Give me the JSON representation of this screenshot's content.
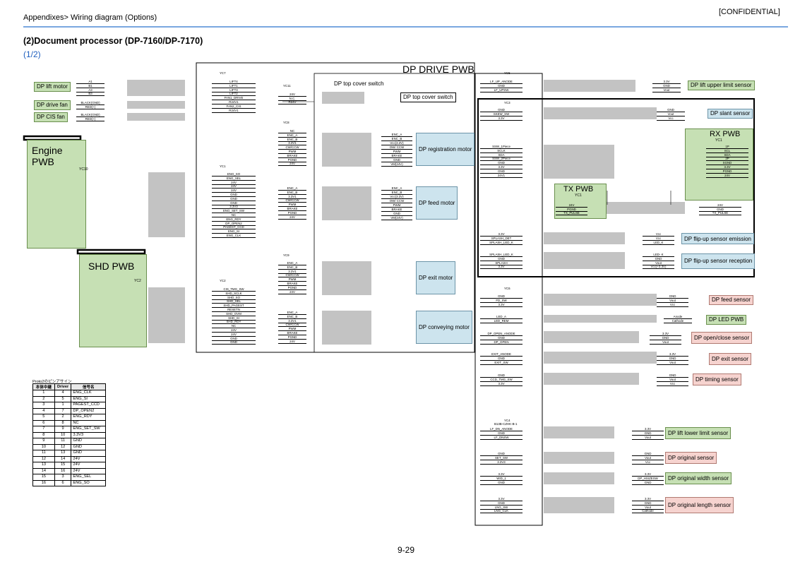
{
  "header": {
    "breadcrumb": "Appendixes> Wiring diagram (Options)",
    "confidential": "[CONFIDENTIAL]"
  },
  "page": {
    "title": "(2)Document processor (DP-7160/DP-7170)",
    "part": "(1/2)",
    "number": "9-29"
  },
  "boards": {
    "dp_drive": "DP DRIVE PWB",
    "engine": "Engine PWB",
    "shd": "SHD PWB",
    "rx": "RX PWB",
    "tx": "TX PWB"
  },
  "connectors": {
    "yc7": "YC7",
    "yc11": "YC11",
    "yc8": "YC8",
    "yc1": "YC1",
    "yc9": "YC9",
    "yc2": "YC2",
    "yc5": "YC5",
    "yc3": "YC3",
    "yc6": "YC6",
    "yc4": "YC4",
    "yc4_part": "B13B-CZHK-B-1",
    "yc10": "YC10",
    "shd_yc2": "YC2",
    "rx_yc1": "YC1",
    "tx_yc1": "YC1"
  },
  "components": {
    "lift_motor": "DP lift motor",
    "drive_fan": "DP drive fan",
    "cis_fan": "DP CIS fan",
    "top_cover_switch_in": "DP top cover switch",
    "top_cover_switch": "DP top cover switch",
    "registration_motor": "DP registration motor",
    "feed_motor": "DP feed motor",
    "exit_motor": "DP exit motor",
    "conveying_motor": "DP conveying motor",
    "lift_upper_limit": "DP lift upper limit sensor",
    "slant_sensor": "DP slant sensor",
    "flipup_emission": "DP flip-up sensor emission",
    "flipup_reception": "DP flip-up sensor reception",
    "feed_sensor": "DP feed sensor",
    "led_pwb": "DP LED PWB",
    "open_close_sensor": "DP open/close sensor",
    "exit_sensor": "DP exit sensor",
    "timing_sensor": "DP timing sensor",
    "lift_lower_limit": "DP lift lower limit sensor",
    "original_sensor": "DP original sensor",
    "original_width": "DP original width sensor",
    "original_length": "DP original length sensor"
  },
  "signals": {
    "lift_motor_wires": [
      "A1",
      "B1",
      "A3",
      "B3"
    ],
    "fan_wires": [
      "BLACK(GND)",
      "RED(+)"
    ],
    "yc7": [
      "LIFT4",
      "LIFT1",
      "LIFT3",
      "LIFT2",
      "FAN1_DRIVE",
      "R24V1",
      "FAN2_CIS",
      "R24V1"
    ],
    "yc11": [
      "24V",
      "N.C.",
      "R24V"
    ],
    "yc8_reg": [
      "NC",
      "ENC_A",
      "ENC_B",
      "3.3V1",
      "CW/CCW",
      "PWM",
      "BRAKE",
      "PGND",
      "24V"
    ],
    "reg_motor": [
      "ENC_A",
      "ENC_B",
      "Vcc(3.3V)",
      "OW/ CCW",
      "PWM",
      "BRAKE",
      "GND",
      "VM(24V)"
    ],
    "yc8_feed": [
      "ENC_A",
      "ENC_B",
      "3.3V1",
      "CW/CCW",
      "PWM",
      "BRAKE",
      "PGND",
      "24V"
    ],
    "feed_motor": [
      "ENC_A",
      "ENC_B",
      "Vcc(3.3V)",
      "OW/ CCW",
      "PWM",
      "BRAKE",
      "GND",
      "VM(24V)"
    ],
    "yc1": [
      "ENG_SO",
      "ENG_SEL",
      "24V",
      "24V",
      "24V",
      "GND",
      "GND",
      "GND",
      "3.3V3",
      "ENG_SET_SW",
      "NC",
      "ENG_RDY",
      "DP_OPEN2",
      "PAGEST_CCD",
      "ENG_SI",
      "ENG_CLK"
    ],
    "yc9_exit": [
      "ENC_A",
      "ENC_B",
      "3.3V1",
      "CW/CCW",
      "PWM",
      "BRAKE",
      "PGND",
      "24V"
    ],
    "yc9_conv": [
      "ENC_A",
      "ENC_B",
      "3.3V1",
      "CW/CCW",
      "PWM",
      "BRAKE",
      "PGND",
      "24V"
    ],
    "yc2": [
      "CIS_TMG_SW",
      "SHD_SCLK",
      "SHD_SO",
      "SHD_SEL",
      "SHD_PAGEST",
      "RESETN",
      "SHD_OVM",
      "SHD_SI",
      "SHD_RDY",
      "NC",
      "24V",
      "24V",
      "GND",
      "GND"
    ],
    "yc5": [
      "LF_UP_ANODE",
      "GND",
      "LF_UPSW"
    ],
    "lift_upper": [
      "3.3V",
      "GND",
      "Vout"
    ],
    "yc3_slant": [
      "GND",
      "SKEW_SW",
      "3.3V"
    ],
    "slant": [
      "GND",
      "Vout",
      "Vcc"
    ],
    "yc3_tx": [
      "SSW_1Piece",
      "SCLK",
      "SDA",
      "SSW_2Piece",
      "GND",
      "3.3V",
      "GND",
      "24V1"
    ],
    "rx": [
      "1P",
      "SCL",
      "SDA",
      "2P",
      "SGND",
      "3.3V",
      "PGND",
      "24V"
    ],
    "tx_in": [
      "24V",
      "PGND",
      "TX_PULSE"
    ],
    "tx_out": [
      "24V",
      "GND",
      "TX_PULSE"
    ],
    "yc3_emit": [
      "3.3V",
      "SPLASH_DET",
      "SPLASH_LED_K"
    ],
    "emit": [
      "Vcc",
      "Vcc",
      "LED_K"
    ],
    "yc3_recv": [
      "SPLASH_LED_K",
      "GND",
      "SPLASH",
      "3.3V"
    ],
    "recv": [
      "LED- K",
      "GND",
      "Vout",
      "Vcc(+3.3V)"
    ],
    "yc6_feed": [
      "GND",
      "FD_SW",
      "3.3V"
    ],
    "feed_s": [
      "GND",
      "Vout",
      "Vcc"
    ],
    "yc6_led": [
      "LED_A",
      "LED_REM"
    ],
    "led": [
      "Anode",
      "Cathode"
    ],
    "yc6_open": [
      "DP_OPEN_ANODE",
      "GND",
      "DP_OPEN"
    ],
    "open": [
      "3.3V",
      "GND",
      "Vout"
    ],
    "yc6_exit": [
      "EXIT_ANODE",
      "GND",
      "EXIT_SW"
    ],
    "exit_s": [
      "3.3V",
      "GND",
      "Vout"
    ],
    "yc6_tmg": [
      "GND",
      "CCD_TMG_SW",
      "3.3V"
    ],
    "tmg": [
      "GND",
      "Vout",
      "Vcc"
    ],
    "yc4_lower": [
      "LF_DN_ANODE",
      "GND",
      "LF_DNSW"
    ],
    "lower": [
      "3.3V",
      "GND",
      "Vout"
    ],
    "yc4_orig": [
      "GND",
      "SET_SW",
      "3.3V3"
    ],
    "orig": [
      "GND",
      "Vout",
      "Vcc"
    ],
    "yc4_width": [
      "3.3V",
      "WID_1",
      "GND"
    ],
    "width": [
      "3.3V",
      "DP_HSIZESW",
      "GND"
    ],
    "yc4_length": [
      "3.3V",
      "GND",
      "LNG_SW",
      "LNG_CLK"
    ],
    "length": [
      "3.3V",
      "GND",
      "Vout",
      "Cathode"
    ]
  },
  "pin_table": {
    "caption": "Proto2のピンアサイン",
    "headers": [
      "本体中継",
      "Driver",
      "信号名"
    ],
    "rows": [
      [
        "1",
        "4",
        "ENG_CLK"
      ],
      [
        "2",
        "5",
        "ENG_SI"
      ],
      [
        "3",
        "1",
        "PAGEST_CCD"
      ],
      [
        "4",
        "7",
        "DP_OPEN2"
      ],
      [
        "5",
        "2",
        "ENG_RDY"
      ],
      [
        "6",
        "8",
        "NC"
      ],
      [
        "7",
        "9",
        "ENG_SET_SW"
      ],
      [
        "8",
        "10",
        "3.3V3"
      ],
      [
        "9",
        "11",
        "GND"
      ],
      [
        "10",
        "12",
        "GND"
      ],
      [
        "11",
        "13",
        "GND"
      ],
      [
        "12",
        "14",
        "24V"
      ],
      [
        "13",
        "15",
        "24V"
      ],
      [
        "14",
        "16",
        "24V"
      ],
      [
        "15",
        "3",
        "ENG_SEL"
      ],
      [
        "16",
        "6",
        "ENG_SO"
      ]
    ]
  },
  "colors": {
    "accent_line": "#7aa7e0",
    "green": "#c6e0b4",
    "blue": "#cde4ee",
    "pink": "#f6d3cf",
    "link": "#1f5fbf"
  }
}
